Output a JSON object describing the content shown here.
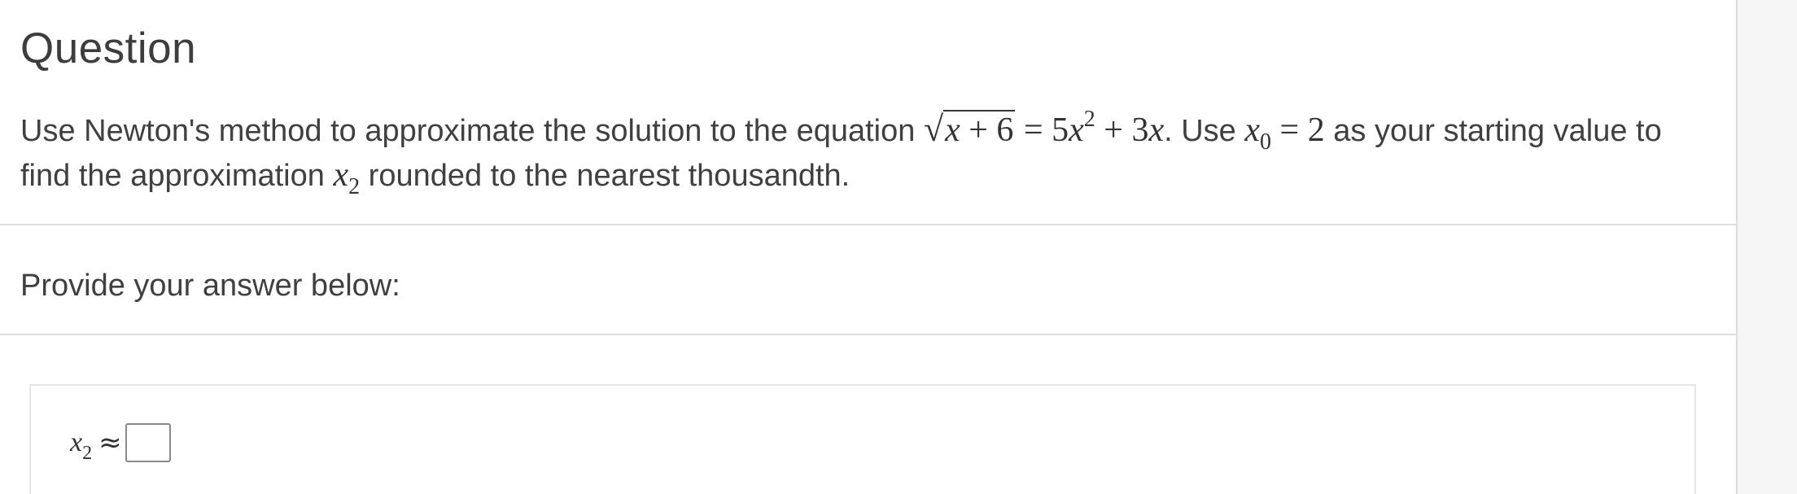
{
  "heading": "Question",
  "question": {
    "lead": "Use Newton's method to approximate the solution to the equation ",
    "equation": {
      "radicand_var": "x",
      "radicand_rest": " + 6",
      "equals": " = 5",
      "x_var": "x",
      "exponent": "2",
      "rest": " + 3",
      "x_var2": "x"
    },
    "mid": ". Use ",
    "start": {
      "var": "x",
      "sub": "0",
      "rest": " = 2"
    },
    "tail_1": " as your starting value to find the approximation ",
    "target": {
      "var": "x",
      "sub": "2"
    },
    "tail_2": " rounded to the nearest thousandth."
  },
  "prompt": "Provide your answer below:",
  "answer": {
    "var": "x",
    "sub": "2",
    "approx_symbol": "≈",
    "value": ""
  }
}
